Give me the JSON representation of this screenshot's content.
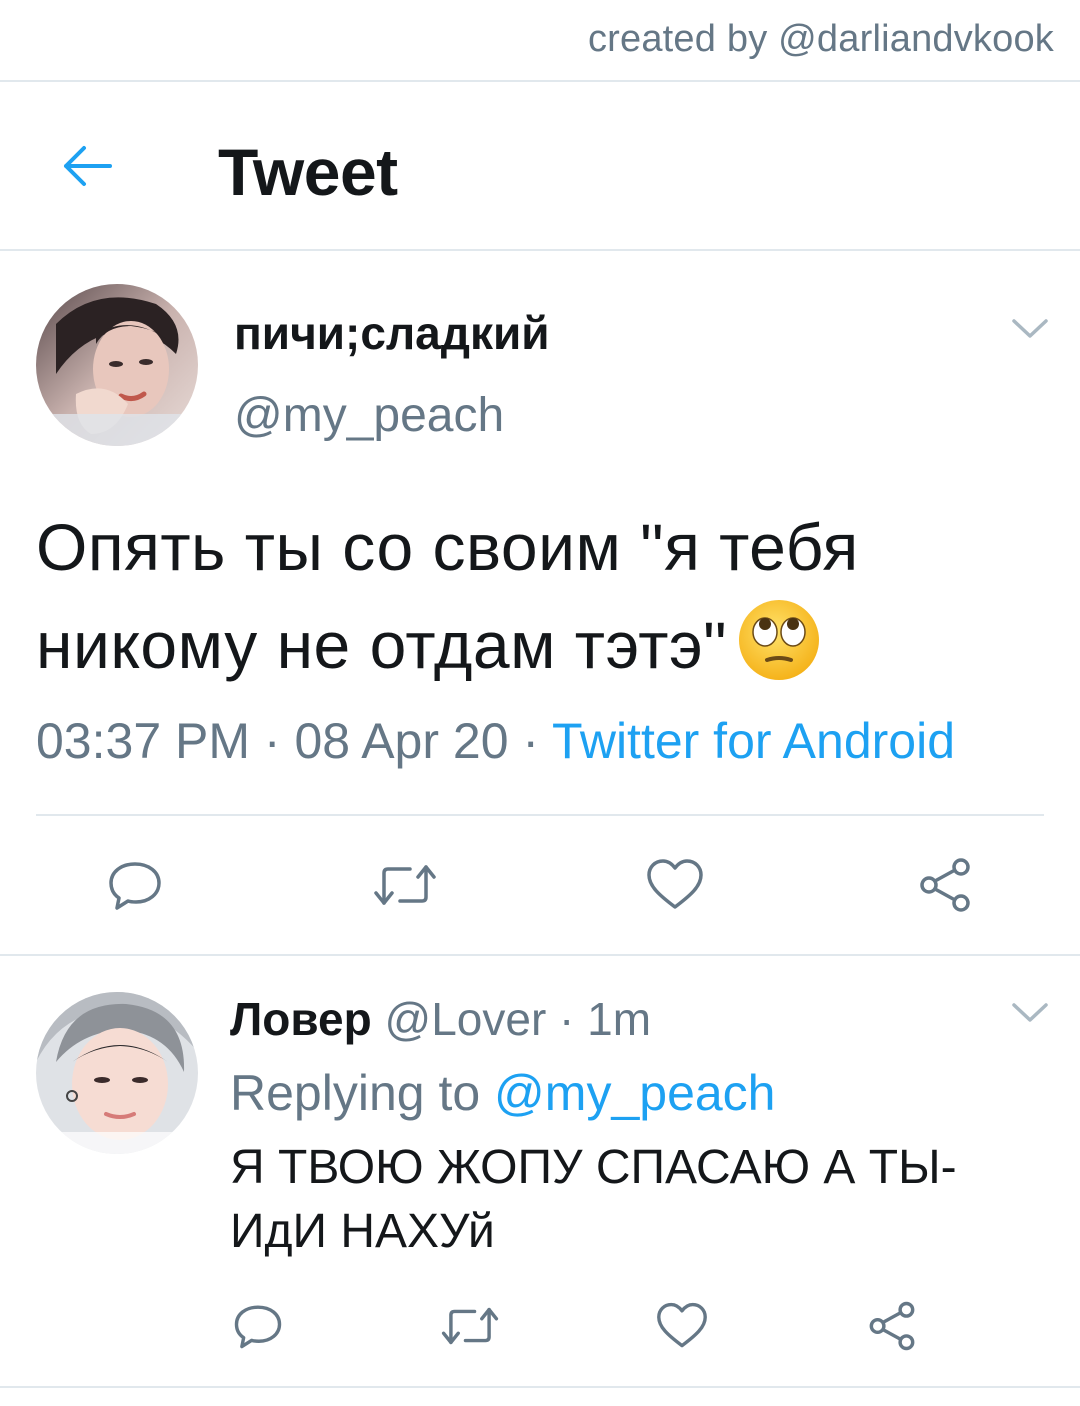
{
  "watermark": "created by @darliandvkook",
  "header": {
    "back_icon": "arrow-left-icon",
    "title": "Tweet"
  },
  "colors": {
    "accent": "#1da1f2",
    "muted": "#657786",
    "text": "#14171a",
    "divider": "#e1e8ed"
  },
  "tweet": {
    "author_name": "пичи;сладкий",
    "author_handle": "@my_peach",
    "text": "Опять ты со своим \"я тебя никому не отдам тэтэ\"",
    "emoji": "face-with-rolling-eyes",
    "time": "03:37 PM",
    "sep1": " · ",
    "date": "08 Apr 20",
    "sep2": " · ",
    "source": "Twitter for Android",
    "actions": [
      "reply-icon",
      "retweet-icon",
      "like-icon",
      "share-icon"
    ]
  },
  "reply": {
    "author_name": "Ловер",
    "author_handle": "@Lover",
    "sep": " · ",
    "time": "1m",
    "replying_prefix": "Replying to ",
    "replying_to": "@my_peach",
    "text": "Я ТВОЮ ЖОПУ СПАСАЮ А ТЫ- ИдИ НАХУй",
    "actions": [
      "reply-icon",
      "retweet-icon",
      "like-icon",
      "share-icon"
    ]
  }
}
